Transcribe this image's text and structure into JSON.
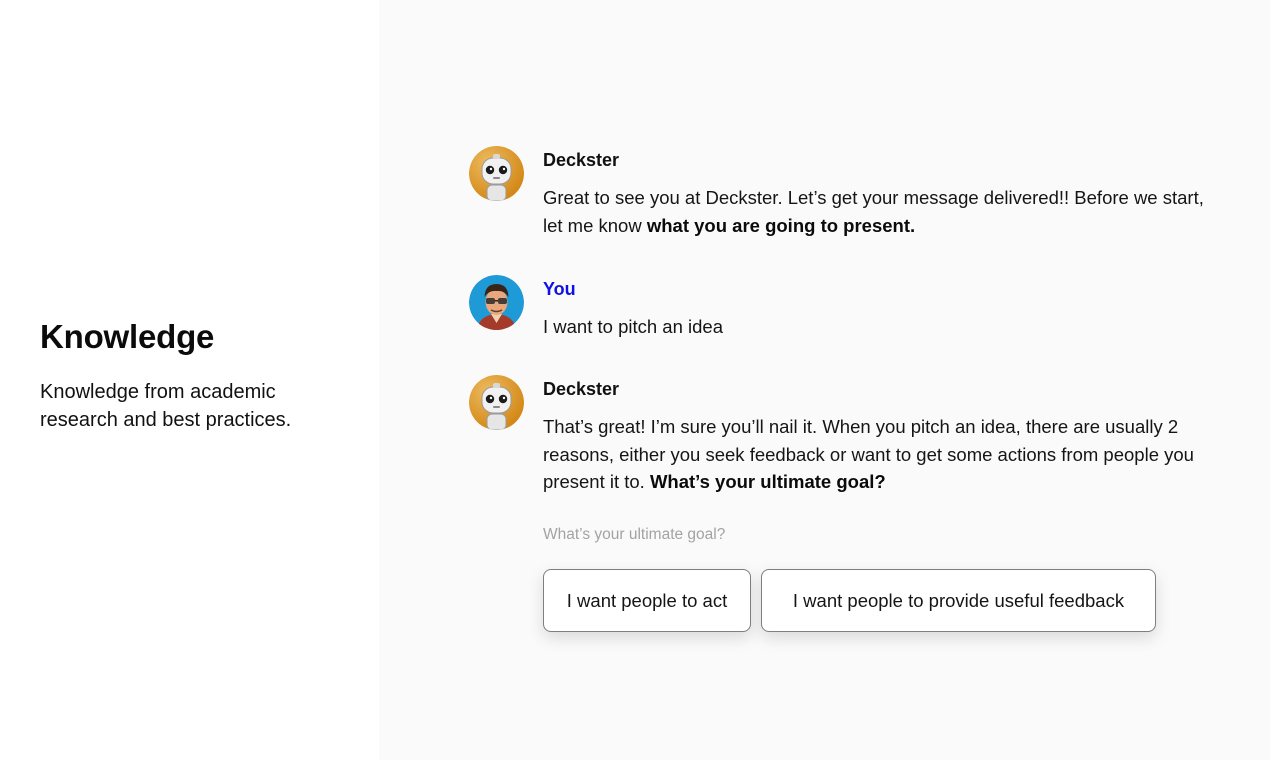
{
  "feature": {
    "title": "Knowledge",
    "description": "Knowledge from academic research and best practices."
  },
  "chat": {
    "messages": [
      {
        "sender": "Deckster",
        "avatar": "robot-avatar-icon",
        "text": "Great to see you at Deckster. Let’s get your message delivered!! Before we start, let me know ",
        "text_bold": "what you are going to present."
      },
      {
        "sender": "You",
        "avatar": "user-avatar-icon",
        "text": "I want to pitch an idea",
        "text_bold": ""
      },
      {
        "sender": "Deckster",
        "avatar": "robot-avatar-icon",
        "text": "That’s great! I’m sure you’ll nail it. When you pitch an idea, there are usually 2 reasons, either you seek feedback or want to get some actions from people you present it to. ",
        "text_bold": "What’s your ultimate goal?"
      }
    ],
    "prompt_label": "What’s your ultimate goal?",
    "choices": [
      "I want people to act",
      "I want people to provide useful feedback"
    ]
  },
  "colors": {
    "you_sender": "#1010e6",
    "panel_background": "#fafafa",
    "robot_avatar_bg": "#e39a1f",
    "user_avatar_bg": "#1e9ad6"
  }
}
